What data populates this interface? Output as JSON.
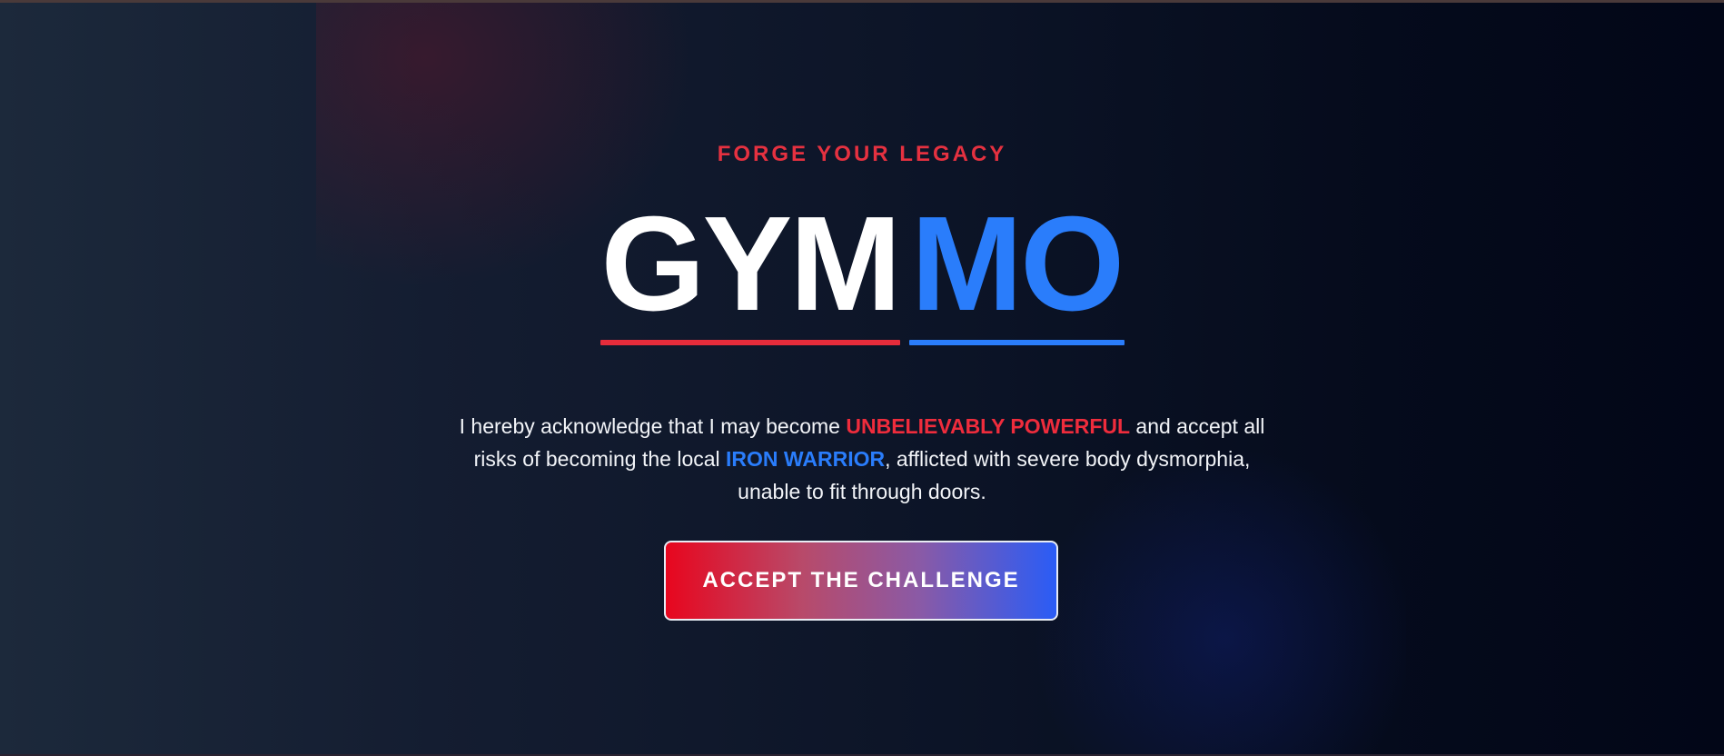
{
  "hero": {
    "tagline": "FORGE YOUR LEGACY",
    "logo": {
      "part1": "GYM",
      "part2": "MO"
    },
    "disclaimer": {
      "segment1": "I hereby acknowledge that I may become ",
      "highlight1": "UNBELIEVABLY POWERFUL",
      "segment2": " and accept all risks of becoming the local ",
      "highlight2": "IRON WARRIOR",
      "segment3": ", afflicted with severe body dysmorphia, unable to fit through doors."
    },
    "cta_label": "ACCEPT THE CHALLENGE"
  },
  "colors": {
    "accent_red": "#e62c3b",
    "accent_blue": "#2a7dfb",
    "background_dark": "#020617"
  }
}
